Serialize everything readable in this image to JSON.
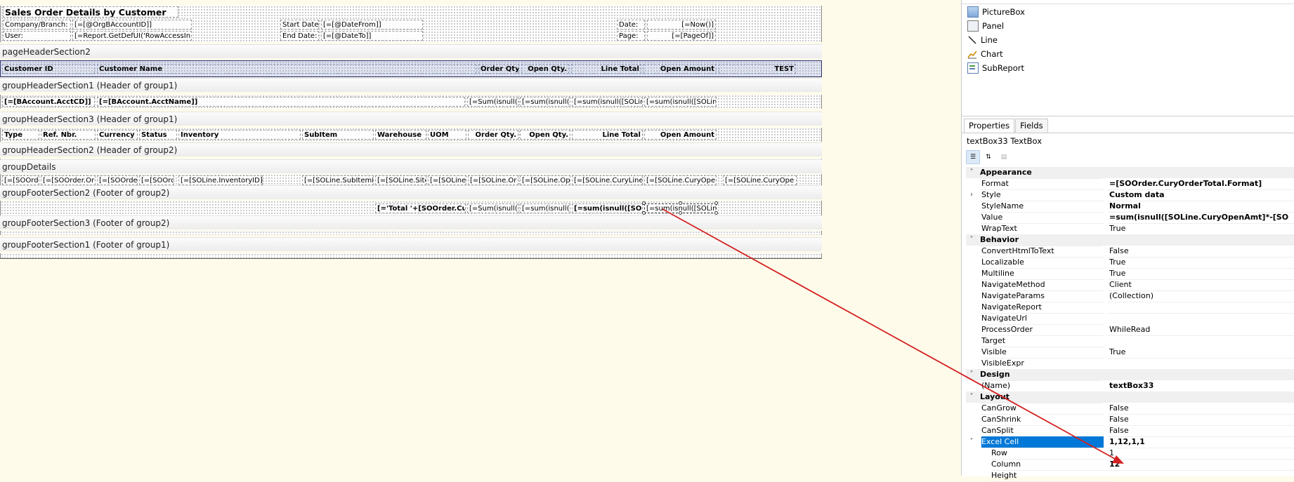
{
  "report": {
    "title": "Sales Order Details by Customer",
    "pageHeader": {
      "company_label": "Company/Branch:",
      "company_value": "[=[@OrgBAccountID]]",
      "user_label": "User:",
      "user_value": "[=Report.GetDefUI('RowAccessIn",
      "start_label": "Start Date:",
      "start_value": "[=[@DateFrom]]",
      "end_label": "End Date:",
      "end_value": "[=[@DateTo]]",
      "date_label": "Date:",
      "date_value": "[=Now()]",
      "page_label": "Page:",
      "page_value": "[=[PageOf]]"
    },
    "bands": {
      "pageHeaderSection2": "pageHeaderSection2",
      "groupHeaderSection1": "groupHeaderSection1 (Header of group1)",
      "groupHeaderSection3": "groupHeaderSection3 (Header of group1)",
      "groupHeaderSection2": "groupHeaderSection2 (Header of group2)",
      "groupDetails": "groupDetails",
      "groupFooterSection2": "groupFooterSection2 (Footer of group2)",
      "groupFooterSection3": "groupFooterSection3 (Footer of group2)",
      "groupFooterSection1": "groupFooterSection1 (Footer of group1)"
    },
    "columnHeaders": {
      "customer_id": "Customer ID",
      "customer_name": "Customer Name",
      "order_qty": "Order Qty.",
      "open_qty": "Open Qty.",
      "line_total": "Line Total",
      "open_amount": "Open Amount",
      "test": "TEST"
    },
    "group1Row": {
      "acct_cd": "[=[BAccount.AcctCD]]",
      "acct_name": "[=[BAccount.AcctName]]",
      "f1": "[=Sum(isnull([",
      "f2": "[=sum(isnull([",
      "f3": "[=sum(isnull([SOLin",
      "f4": "[=sum(isnull([SOLin"
    },
    "group3Headers": {
      "type": "Type",
      "ref": "Ref. Nbr.",
      "currency": "Currency",
      "status": "Status",
      "inventory": "Inventory",
      "subitem": "SubItem",
      "warehouse": "Warehouse",
      "uom": "UOM",
      "order_qty": "Order Qty.",
      "open_qty": "Open Qty.",
      "line_total": "Line Total",
      "open_amount": "Open Amount"
    },
    "detailRow": {
      "c1": "[=[SOOrd",
      "c2": "[=[SOOrder.Or",
      "c3": "[=[SOOrder",
      "c4": "[=[SOOrd",
      "c5": "[=[SOLine.InventoryID]]",
      "c6": "[=[SOLine.SubItemI",
      "c7": "[=[SOLine.Site",
      "c8": "[=[SOLine.",
      "c9": "[=[SOLine.Or",
      "c10": "[=[SOLine.Op",
      "c11": "[=[SOLine.CuryLine",
      "c12": "[=[SOLine.CuryOpe",
      "c13": "[=[SOLine.CuryOpe"
    },
    "footer2Row": {
      "total": "[='Total '+[SOOrder.Cury",
      "f1": "[=Sum(isnull([",
      "f2": "[=sum(isnull([",
      "f3": "[=sum(isnull([SOLin",
      "f4": "[=sum(isnull([SOLin"
    }
  },
  "toolbox": {
    "items": [
      {
        "label": "PictureBox",
        "icon": "picturebox-icon"
      },
      {
        "label": "Panel",
        "icon": "panel-icon"
      },
      {
        "label": "Line",
        "icon": "line-icon"
      },
      {
        "label": "Chart",
        "icon": "chart-icon"
      },
      {
        "label": "SubReport",
        "icon": "subreport-icon"
      }
    ]
  },
  "properties": {
    "tabs": [
      "Properties",
      "Fields"
    ],
    "object": "textBox33 TextBox",
    "rows": [
      {
        "kind": "cat",
        "name": "Appearance"
      },
      {
        "name": "Format",
        "value": "=[SOOrder.CuryOrderTotal.Format]",
        "bold": true
      },
      {
        "name": "Style",
        "value": "Custom data",
        "bold": true,
        "expandable": true
      },
      {
        "name": "StyleName",
        "value": "Normal",
        "bold": true
      },
      {
        "name": "Value",
        "value": "=sum(isnull([SOLine.CuryOpenAmt]*-[SO",
        "bold": true
      },
      {
        "name": "WrapText",
        "value": "True"
      },
      {
        "kind": "cat",
        "name": "Behavior"
      },
      {
        "name": "ConvertHtmlToText",
        "value": "False"
      },
      {
        "name": "Localizable",
        "value": "True"
      },
      {
        "name": "Multiline",
        "value": "True"
      },
      {
        "name": "NavigateMethod",
        "value": "Client"
      },
      {
        "name": "NavigateParams",
        "value": "(Collection)"
      },
      {
        "name": "NavigateReport",
        "value": ""
      },
      {
        "name": "NavigateUrl",
        "value": ""
      },
      {
        "name": "ProcessOrder",
        "value": "WhileRead"
      },
      {
        "name": "Target",
        "value": ""
      },
      {
        "name": "Visible",
        "value": "True"
      },
      {
        "name": "VisibleExpr",
        "value": ""
      },
      {
        "kind": "cat",
        "name": "Design"
      },
      {
        "name": "(Name)",
        "value": "textBox33",
        "bold": true
      },
      {
        "kind": "cat",
        "name": "Layout"
      },
      {
        "name": "CanGrow",
        "value": "False"
      },
      {
        "name": "CanShrink",
        "value": "False"
      },
      {
        "name": "CanSplit",
        "value": "False"
      },
      {
        "name": "Excel Cell",
        "value": "1,12,1,1",
        "bold": true,
        "selected": true,
        "expanded": true
      },
      {
        "kind": "sub",
        "name": "Row",
        "value": "1"
      },
      {
        "kind": "sub",
        "name": "Column",
        "value": "12",
        "bold": true
      },
      {
        "kind": "sub",
        "name": "Height",
        "value": ""
      }
    ]
  },
  "colors": {
    "canvas": "#fffbeb",
    "selection": "#0078d7",
    "arrow": "#d42020"
  }
}
